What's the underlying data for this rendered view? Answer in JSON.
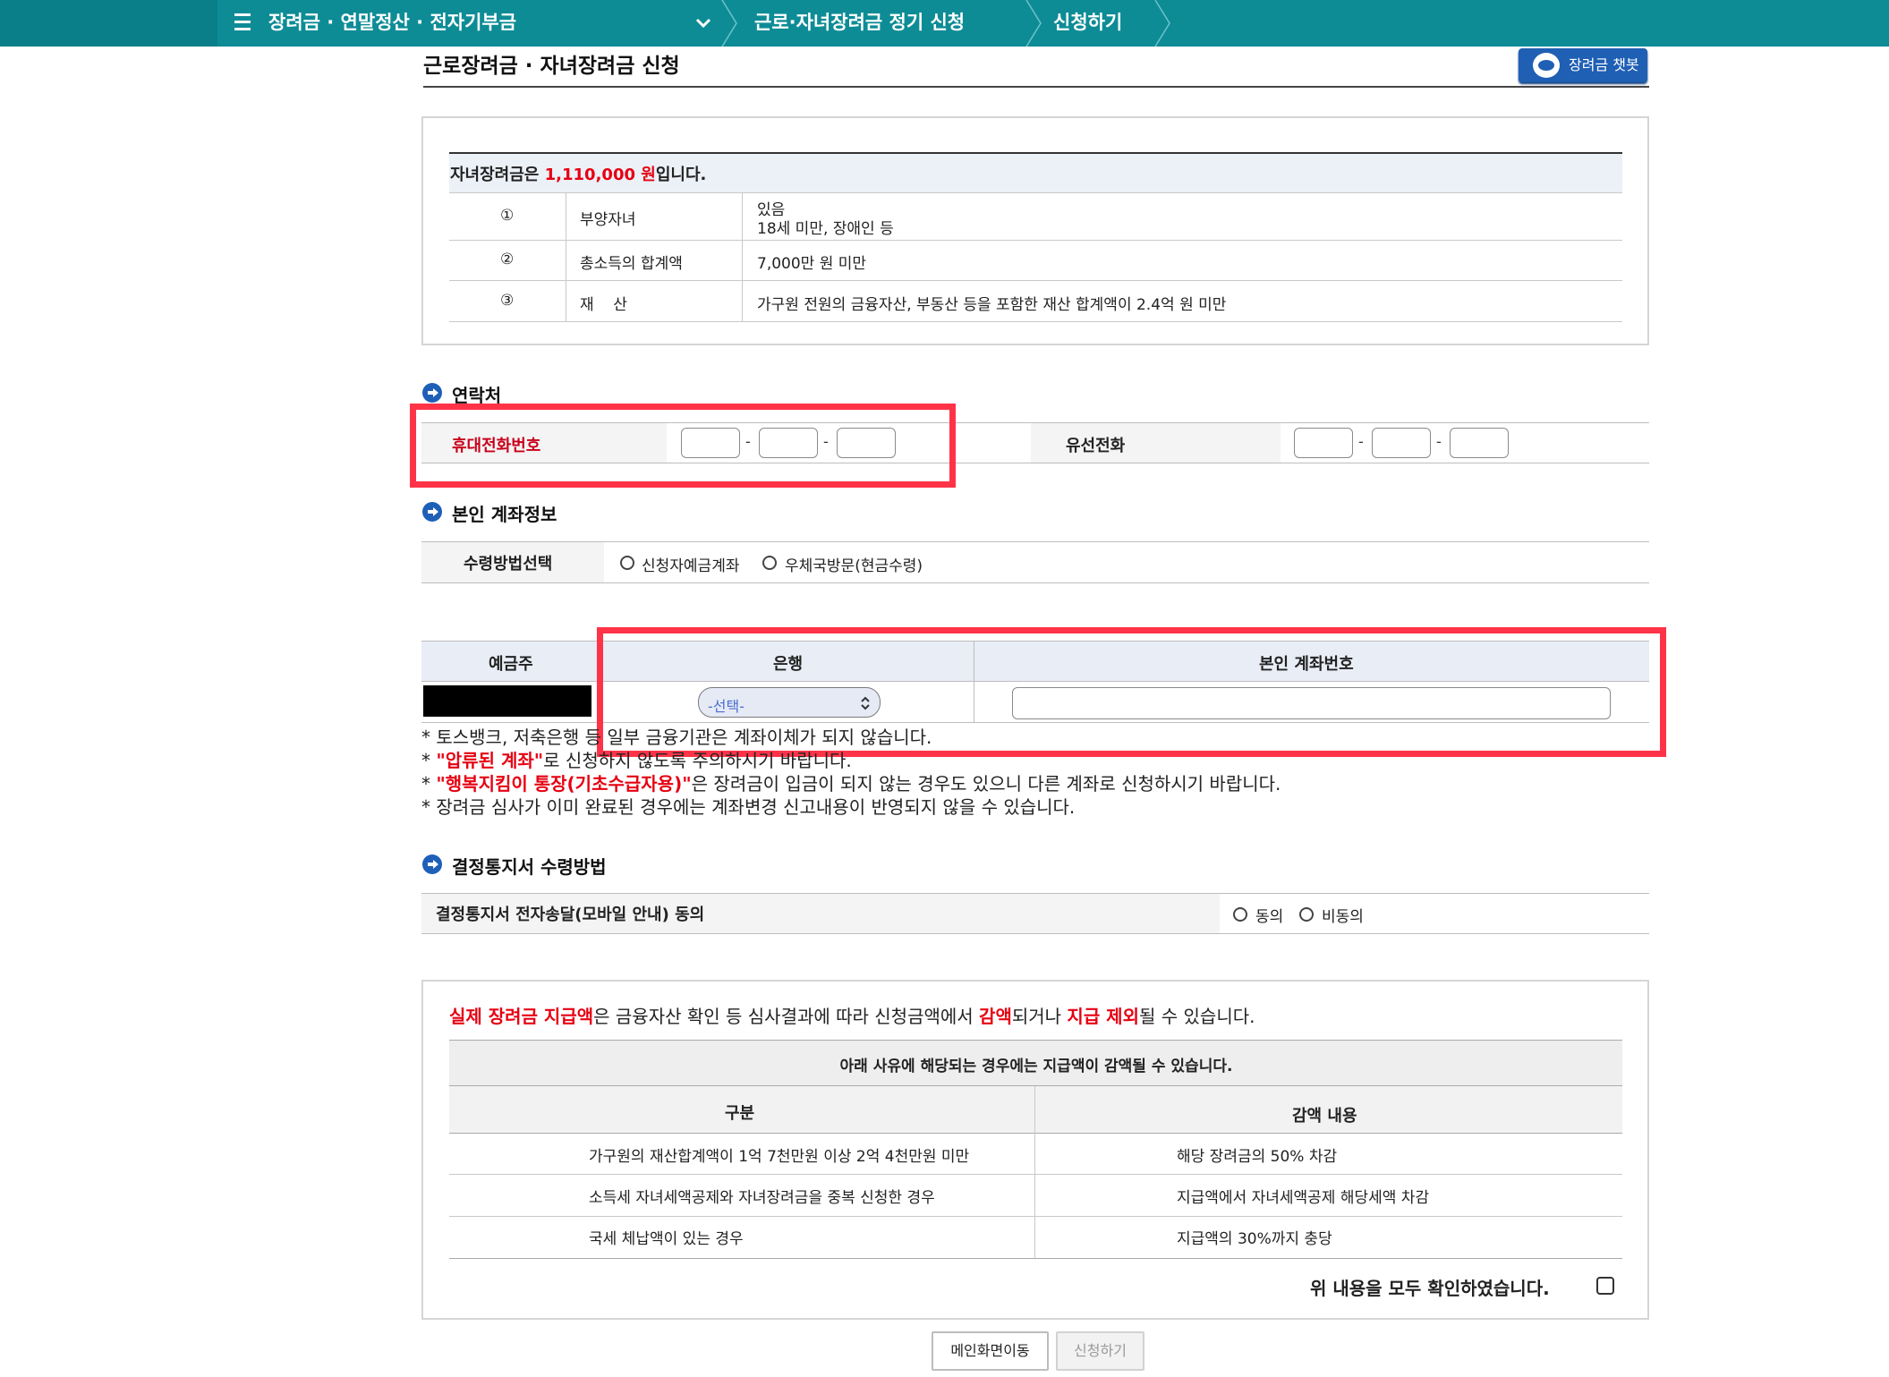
{
  "nav": {
    "crumb1": "장려금 · 연말정산 · 전자기부금",
    "crumb2": "근로·자녀장려금 정기 신청",
    "crumb3": "신청하기"
  },
  "page": {
    "title": "근로장려금 · 자녀장려금 신청",
    "chatbot_label": "장려금 챗봇"
  },
  "eligibility": {
    "head_prefix": "자녀장려금은 ",
    "amount": "1,110,000 원",
    "head_suffix": "입니다.",
    "rows": [
      {
        "no": "①",
        "item": "부양자녀",
        "line1": "있음",
        "line2": "18세 미만, 장애인 등"
      },
      {
        "no": "②",
        "item": "총소득의 합계액",
        "line1": "7,000만 원 미만"
      },
      {
        "no": "③",
        "item": "재    산",
        "line1": "가구원 전원의 금융자산, 부동산 등을 포함한 재산 합계액이 2.4억 원 미만"
      }
    ]
  },
  "contact": {
    "section_title": "연락처",
    "mobile_label": "휴대전화번호",
    "landline_label": "유선전화",
    "dash": "-"
  },
  "account": {
    "section_title": "본인 계좌정보",
    "method_label": "수령방법선택",
    "option1": "신청자예금계좌",
    "option2": "우체국방문(현금수령)",
    "col_holder": "예금주",
    "col_bank": "은행",
    "col_account": "본인 계좌번호",
    "bank_select": "-선택-",
    "notes": [
      "* 토스뱅크, 저축은행 등 일부 금융기관은 계좌이체가 되지 않습니다.",
      "* ",
      "* ",
      "* 장려금 심사가 이미 완료된 경우에는 계좌변경 신고내용이 반영되지 않을 수 있습니다."
    ],
    "note2_red": "\"압류된 계좌\"",
    "note2_rest": "로 신청하지 않도록 주의하시기 바랍니다.",
    "note3_red": "\"행복지킴이 통장(기초수급자용)\"",
    "note3_rest": "은 장려금이 입금이 되지 않는 경우도 있으니 다른 계좌로 신청하시기 바랍니다."
  },
  "notice": {
    "section_title": "결정통지서 수령방법",
    "consent_label": "결정통지서 전자송달(모바일 안내) 동의",
    "agree": "동의",
    "disagree": "비동의"
  },
  "reduction": {
    "p1_red": "실제 장려금 지급액",
    "p1": "은 금융자산 확인 등 심사결과에 따라 신청금액에서 ",
    "p2_red": "감액",
    "p2": "되거나 ",
    "p3_red": "지급 제외",
    "p3": "될 수 있습니다.",
    "table_head": "아래 사유에 해당되는 경우에는 지급액이 감액될 수 있습니다.",
    "col1": "구분",
    "col2": "감액 내용",
    "rows": [
      {
        "reason": "가구원의 재산합계액이 1억 7천만원 이상 2억 4천만원 미만",
        "effect": "해당 장려금의 50% 차감"
      },
      {
        "reason": "소득세 자녀세액공제와 자녀장려금을 중복 신청한 경우",
        "effect": "지급액에서 자녀세액공제 해당세액 차감"
      },
      {
        "reason": "국세 체납액이 있는 경우",
        "effect": "지급액의 30%까지 충당"
      }
    ],
    "confirm": "위 내용을 모두 확인하였습니다."
  },
  "buttons": {
    "main": "메인화면이동",
    "apply": "신청하기"
  },
  "colors": {
    "nav_bg": "#0d8c96",
    "accent_red": "#e60012",
    "highlight_box": "#ff3347",
    "chatbot_bg": "#1f5fb4"
  }
}
